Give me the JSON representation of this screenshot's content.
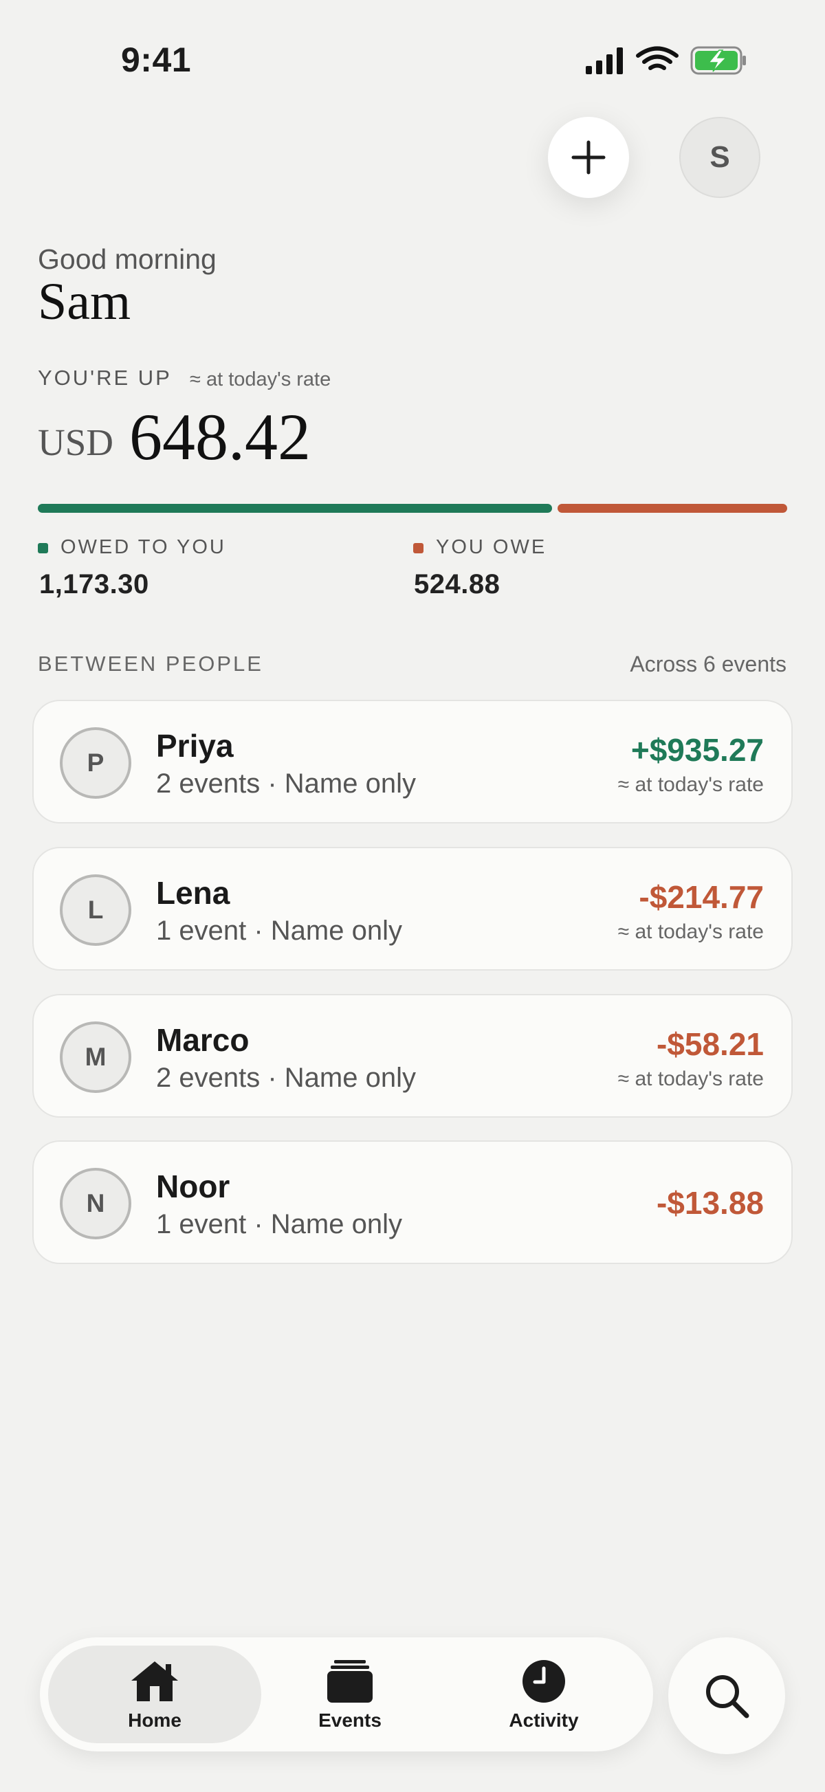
{
  "status_bar": {
    "time": "9:41"
  },
  "header": {
    "add_icon": "plus-icon",
    "profile_initial": "S"
  },
  "greeting": {
    "salutation": "Good morning",
    "name": "Sam"
  },
  "summary": {
    "label": "YOU'RE UP",
    "rate_note": "≈ at today's rate",
    "currency": "USD",
    "amount": "648.42",
    "owed_to_you_label": "OWED TO YOU",
    "owed_to_you_value": "1,173.30",
    "you_owe_label": "YOU OWE",
    "you_owe_value": "524.88",
    "owed_fraction": 0.691
  },
  "people_section": {
    "title": "BETWEEN PEOPLE",
    "note": "Across 6 events"
  },
  "people": [
    {
      "initial": "P",
      "name": "Priya",
      "subtitle": "2 events · Name only",
      "amount": "+$935.27",
      "rate_note": "≈ at today's rate",
      "direction": "positive"
    },
    {
      "initial": "L",
      "name": "Lena",
      "subtitle": "1 event · Name only",
      "amount": "-$214.77",
      "rate_note": "≈ at today's rate",
      "direction": "negative"
    },
    {
      "initial": "M",
      "name": "Marco",
      "subtitle": "2 events · Name only",
      "amount": "-$58.21",
      "rate_note": "≈ at today's rate",
      "direction": "negative"
    },
    {
      "initial": "N",
      "name": "Noor",
      "subtitle": "1 event · Name only",
      "amount": "-$13.88",
      "rate_note": "",
      "direction": "negative"
    }
  ],
  "tabs": [
    {
      "label": "Home",
      "icon": "home-icon",
      "active": true
    },
    {
      "label": "Events",
      "icon": "stack-icon",
      "active": false
    },
    {
      "label": "Activity",
      "icon": "clock-icon",
      "active": false
    }
  ],
  "search": {
    "icon": "search-icon"
  },
  "colors": {
    "positive": "#1f7a58",
    "negative": "#c05838",
    "background": "#f2f2f0",
    "card": "#fbfbf9"
  }
}
